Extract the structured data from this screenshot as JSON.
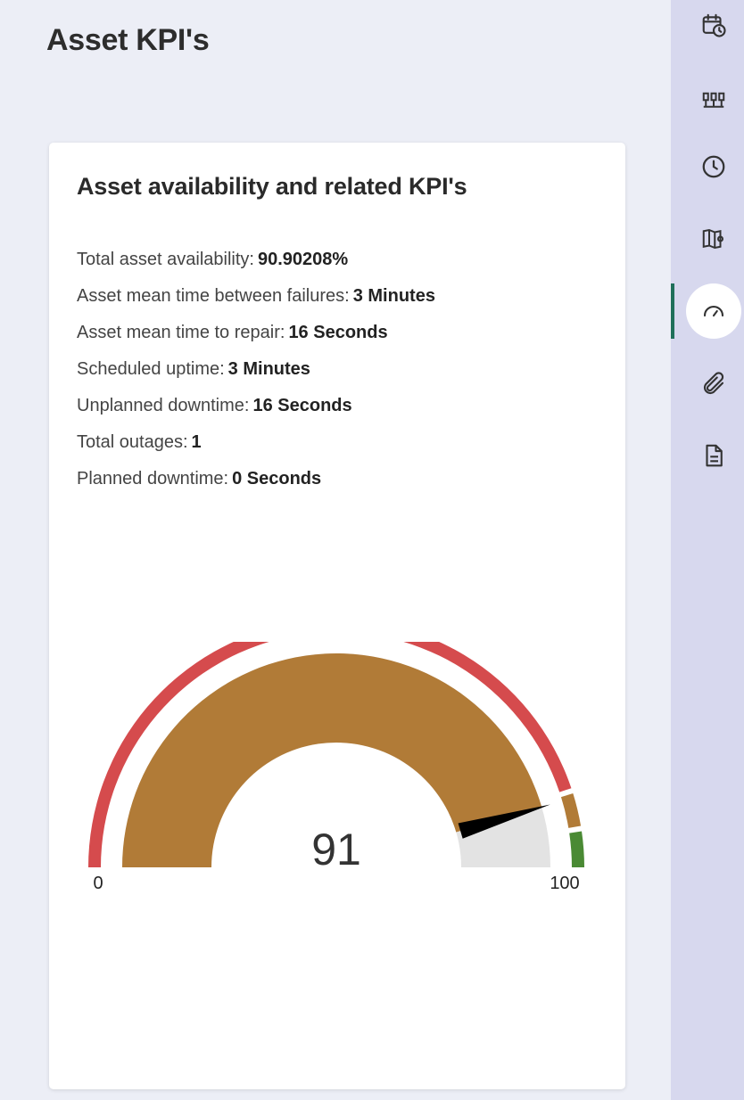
{
  "page": {
    "title": "Asset KPI's"
  },
  "card": {
    "title": "Asset availability and related KPI's",
    "kpis": [
      {
        "label": "Total asset availability:",
        "value": "90.90208%"
      },
      {
        "label": "Asset mean time between failures:",
        "value": "3 Minutes"
      },
      {
        "label": "Asset mean time to repair:",
        "value": "16 Seconds"
      },
      {
        "label": "Scheduled uptime:",
        "value": "3 Minutes"
      },
      {
        "label": "Unplanned downtime:",
        "value": "16 Seconds"
      },
      {
        "label": "Total outages:",
        "value": "1"
      },
      {
        "label": "Planned downtime:",
        "value": "0 Seconds"
      }
    ]
  },
  "gauge": {
    "value": 90.90208,
    "display_value": "91",
    "min": 0,
    "max": 100,
    "min_label": "0",
    "max_label": "100",
    "bands": [
      {
        "from": 0,
        "to": 90,
        "color": "#d54b4d"
      },
      {
        "from": 90,
        "to": 95,
        "color": "#b17b37"
      },
      {
        "from": 95,
        "to": 100,
        "color": "#4a8a34"
      }
    ],
    "fill_color": "#b17b37",
    "track_color": "#e3e3e3",
    "needle_color": "#000000"
  },
  "sidebar": {
    "active_index": 4,
    "items": [
      {
        "icon": "calendar-clock-icon"
      },
      {
        "icon": "org-chart-icon"
      },
      {
        "icon": "clock-icon"
      },
      {
        "icon": "map-panel-icon"
      },
      {
        "icon": "speedometer-icon"
      },
      {
        "icon": "paperclip-icon"
      },
      {
        "icon": "document-icon"
      }
    ]
  }
}
